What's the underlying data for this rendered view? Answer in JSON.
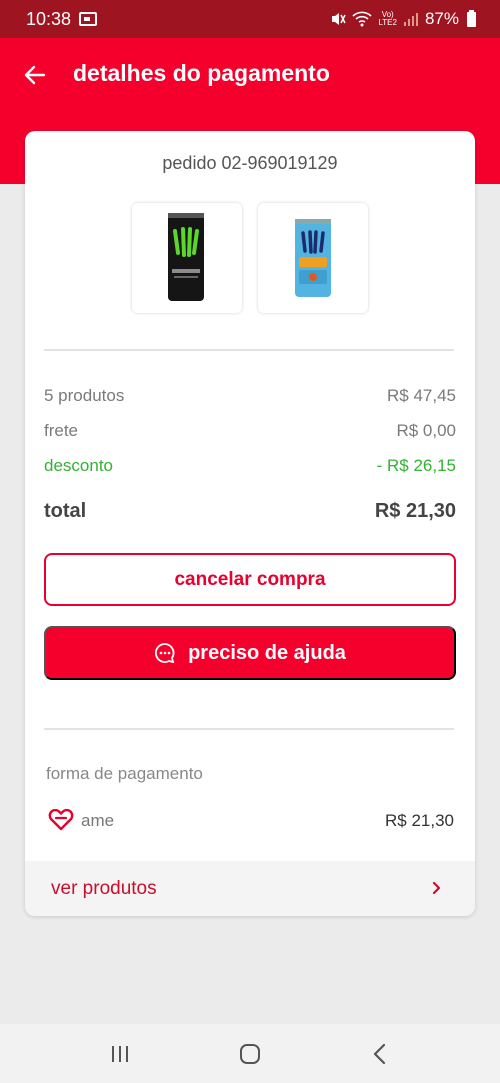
{
  "status_bar": {
    "time": "10:38",
    "network": "LTE2",
    "volte": "Vo)",
    "battery": "87%"
  },
  "header": {
    "title": "detalhes do pagamento",
    "back_icon": "arrow-left-icon"
  },
  "order": {
    "id_label": "pedido 02-969019129",
    "products": [
      {
        "name": "Monster Energy",
        "icon": "monster-energy-can",
        "color": "#111111"
      },
      {
        "name": "Monster Juice",
        "icon": "monster-juice-can",
        "color": "#4aa8d8"
      }
    ]
  },
  "summary": {
    "products_label": "5 produtos",
    "products_value": "R$ 47,45",
    "shipping_label": "frete",
    "shipping_value": "R$ 0,00",
    "discount_label": "desconto",
    "discount_value": "- R$ 26,15",
    "total_label": "total",
    "total_value": "R$ 21,30"
  },
  "actions": {
    "cancel_label": "cancelar compra",
    "help_label": "preciso de ajuda",
    "help_icon": "chat-bubble-icon"
  },
  "payment": {
    "heading": "forma de pagamento",
    "method_label": "ame",
    "method_icon": "ame-heart-icon",
    "amount": "R$ 21,30"
  },
  "footer_link": {
    "label": "ver produtos",
    "icon": "chevron-right-icon"
  },
  "nav_bar": {
    "buttons": [
      "recent-apps-icon",
      "home-icon",
      "back-icon"
    ]
  },
  "colors": {
    "brand_red": "#f5002d",
    "status_bar": "#9e1420",
    "discount_green": "#33b233"
  }
}
